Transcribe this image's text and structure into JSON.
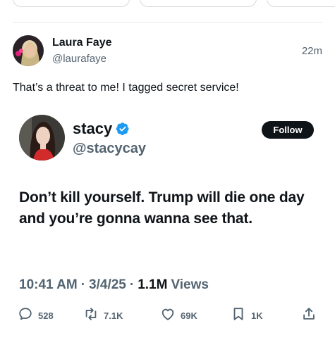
{
  "reply": {
    "name": "Laura Faye",
    "handle": "@laurafaye",
    "time": "22m",
    "text": "That’s a threat to me! I tagged secret service!"
  },
  "quoted_post": {
    "name": "stacy",
    "handle": "@stacycay",
    "follow_label": "Follow",
    "text": "Don’t kill yourself. Trump will die one day and you’re gonna wanna see that.",
    "time": "10:41 AM",
    "date": "3/4/25",
    "separator": "·",
    "views_count": "1.1M",
    "views_label": "Views"
  },
  "actions": {
    "replies": "528",
    "reposts": "7.1K",
    "likes": "69K",
    "bookmarks": "1K"
  },
  "colors": {
    "text": "#0f1419",
    "secondary": "#536471",
    "verified": "#1d9bf0",
    "divider": "#e7e9ea"
  },
  "icons": [
    "verified-badge-icon",
    "reply-icon",
    "repost-icon",
    "like-icon",
    "bookmark-icon",
    "share-icon"
  ]
}
